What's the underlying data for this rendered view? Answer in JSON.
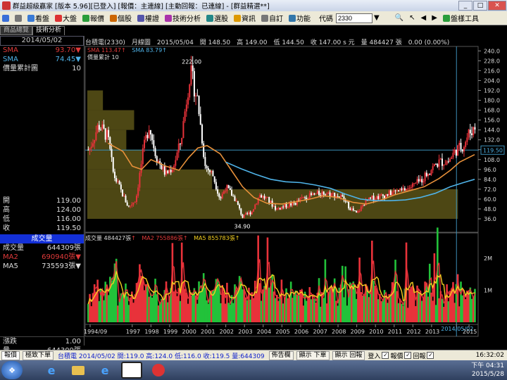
{
  "window": {
    "title": "群益超級贏家 [版本 5.96][已登入] [報價：主連線] [主動回報：已連線] - [群益精選**]",
    "minimize_label": "_",
    "maximize_label": "□",
    "close_label": "✕"
  },
  "menubar": {
    "items": [
      {
        "label": "看盤",
        "icon": "screen-icon",
        "color": "#3a7bd5"
      },
      {
        "label": "大盤",
        "icon": "chart-icon",
        "color": "#d33"
      },
      {
        "label": "報價",
        "icon": "quote-icon",
        "color": "#2a9d3a"
      },
      {
        "label": "個股",
        "icon": "stock-icon",
        "color": "#c60"
      },
      {
        "label": "權證",
        "icon": "warrant-icon",
        "color": "#55a"
      },
      {
        "label": "技術分析",
        "icon": "analysis-icon",
        "color": "#a3a"
      },
      {
        "label": "選股",
        "icon": "screening-icon",
        "color": "#288"
      },
      {
        "label": "資訊",
        "icon": "info-icon",
        "color": "#d90"
      },
      {
        "label": "自訂",
        "icon": "custom-icon",
        "color": "#777"
      },
      {
        "label": "功能",
        "icon": "function-icon",
        "color": "#37a"
      }
    ],
    "code_label": "代碼",
    "code_value": "2330",
    "toolbox_label": "盤樣工具"
  },
  "tabs": [
    {
      "label": "商品總覽",
      "active": false
    },
    {
      "label": "技術分析",
      "active": true
    }
  ],
  "left_panel": {
    "date": "2014/05/02",
    "indicators": [
      {
        "label": "SMA",
        "value": "93.70",
        "arrow": "▼",
        "color": "#e03a3a"
      },
      {
        "label": "SMA",
        "value": "74.45",
        "arrow": "▼",
        "color": "#4fb3e8"
      },
      {
        "label": "價量累計圖",
        "value": "10",
        "arrow": "",
        "color": "#dddddd"
      }
    ],
    "ohlc": [
      {
        "label": "開",
        "value": "119.00"
      },
      {
        "label": "高",
        "value": "124.00"
      },
      {
        "label": "低",
        "value": "116.00"
      },
      {
        "label": "收",
        "value": "119.50"
      }
    ],
    "volume_title": "成交量",
    "volume": [
      {
        "label": "成交量",
        "value": "644309張",
        "arrow": "",
        "color": "#dddddd"
      },
      {
        "label": "MA2",
        "value": "690940張",
        "arrow": "▼",
        "color": "#e03a3a"
      },
      {
        "label": "MA5",
        "value": "735593張",
        "arrow": "▼",
        "color": "#dddddd"
      }
    ],
    "change_label": "漲跌",
    "change_value": "1.00",
    "qty_label": "量",
    "qty_value": "644309張"
  },
  "chart_header": "台積電(2330)　月線圖　2015/05/04　開 148.50　高 149.00　低 144.50　收 147.00 s 元　量 484427 張　0.00 (0.00%)",
  "chart_indicator_legend": {
    "sma1_label": "SMA",
    "sma1_value": "113.47",
    "sma2_label": "SMA",
    "sma2_value": "83.79",
    "vp_label": "價量累計 10"
  },
  "volume_legend": {
    "vol_label": "成交量",
    "vol_value": "484427張",
    "ma2_label": "MA2",
    "ma2_value": "755886張",
    "ma5_label": "MA5",
    "ma5_value": "855783張"
  },
  "chart_data": [
    {
      "type": "candlestick",
      "title": "台積電(2330) 月線圖",
      "ylim": [
        30,
        242
      ],
      "yticks": [
        "240.0",
        "228.0",
        "216.0",
        "204.0",
        "192.0",
        "180.0",
        "168.0",
        "156.0",
        "144.0",
        "132.0",
        "120.0",
        "108.0",
        "96.0",
        "84.0",
        "72.0",
        "60.0",
        "48.0",
        "36.0"
      ],
      "current_price_label": "119.50",
      "annotations": [
        {
          "label": "222.00",
          "year": 2000.1,
          "value": 222
        },
        {
          "label": "34.90",
          "year": 2002.9,
          "value": 34.9
        }
      ],
      "x_axis": [
        "1994/09",
        "1997",
        "1998",
        "1999",
        "2000",
        "2001",
        "2002",
        "2003",
        "2004",
        "2005",
        "2006",
        "2007",
        "2008",
        "2009",
        "2010",
        "2011",
        "2012",
        "2013",
        "2014/05/02",
        "2015"
      ],
      "cursor_year": 2014.33,
      "close_series": [
        [
          1994.7,
          120
        ],
        [
          1995.2,
          150
        ],
        [
          1995.7,
          135
        ],
        [
          1996.0,
          90
        ],
        [
          1996.4,
          70
        ],
        [
          1996.8,
          50
        ],
        [
          1997.2,
          60
        ],
        [
          1997.6,
          120
        ],
        [
          1997.9,
          150
        ],
        [
          1998.3,
          110
        ],
        [
          1998.8,
          90
        ],
        [
          1999.2,
          100
        ],
        [
          1999.6,
          130
        ],
        [
          2000.1,
          215
        ],
        [
          2000.5,
          180
        ],
        [
          2000.9,
          100
        ],
        [
          2001.3,
          90
        ],
        [
          2001.7,
          60
        ],
        [
          2002.0,
          75
        ],
        [
          2002.5,
          60
        ],
        [
          2002.9,
          38
        ],
        [
          2003.4,
          45
        ],
        [
          2003.8,
          65
        ],
        [
          2004.2,
          60
        ],
        [
          2004.7,
          48
        ],
        [
          2005.2,
          52
        ],
        [
          2005.7,
          55
        ],
        [
          2006.2,
          62
        ],
        [
          2006.7,
          65
        ],
        [
          2007.2,
          68
        ],
        [
          2007.7,
          66
        ],
        [
          2008.2,
          62
        ],
        [
          2008.7,
          48
        ],
        [
          2009.0,
          42
        ],
        [
          2009.4,
          55
        ],
        [
          2009.9,
          62
        ],
        [
          2010.4,
          64
        ],
        [
          2010.9,
          68
        ],
        [
          2011.4,
          70
        ],
        [
          2011.9,
          75
        ],
        [
          2012.4,
          82
        ],
        [
          2012.9,
          95
        ],
        [
          2013.4,
          105
        ],
        [
          2013.9,
          106
        ],
        [
          2014.3,
          119.5
        ],
        [
          2014.7,
          125
        ],
        [
          2015.0,
          140
        ],
        [
          2015.3,
          147
        ]
      ],
      "sma1_series": [
        [
          1995.7,
          128
        ],
        [
          1996.5,
          118
        ],
        [
          1997.0,
          100
        ],
        [
          1997.5,
          96
        ],
        [
          1998.0,
          108
        ],
        [
          1998.8,
          100
        ],
        [
          1999.5,
          95
        ],
        [
          2000.0,
          110
        ],
        [
          2000.5,
          122
        ],
        [
          2001.0,
          125
        ],
        [
          2001.7,
          115
        ],
        [
          2002.3,
          95
        ],
        [
          2002.9,
          75
        ],
        [
          2003.5,
          62
        ],
        [
          2004.2,
          55
        ],
        [
          2005.0,
          54
        ],
        [
          2005.8,
          57
        ],
        [
          2006.5,
          60
        ],
        [
          2007.2,
          64
        ],
        [
          2008.0,
          62
        ],
        [
          2008.8,
          56
        ],
        [
          2009.5,
          54
        ],
        [
          2010.2,
          58
        ],
        [
          2011.0,
          65
        ],
        [
          2011.8,
          70
        ],
        [
          2012.6,
          75
        ],
        [
          2013.4,
          85
        ],
        [
          2014.0,
          95
        ],
        [
          2014.5,
          105
        ],
        [
          2015.3,
          114
        ]
      ],
      "sma2_series": [
        [
          2002.0,
          105
        ],
        [
          2002.8,
          97
        ],
        [
          2003.6,
          90
        ],
        [
          2004.4,
          84
        ],
        [
          2005.2,
          81
        ],
        [
          2006.0,
          80
        ],
        [
          2006.8,
          77
        ],
        [
          2007.6,
          73
        ],
        [
          2008.4,
          66
        ],
        [
          2009.2,
          60
        ],
        [
          2010.0,
          58
        ],
        [
          2010.8,
          58
        ],
        [
          2011.6,
          59
        ],
        [
          2012.4,
          62
        ],
        [
          2013.2,
          67
        ],
        [
          2014.0,
          75
        ],
        [
          2014.7,
          80
        ],
        [
          2015.3,
          84
        ]
      ],
      "volume_profile": [
        {
          "price_low": 36,
          "price_high": 72,
          "weight": 0.95
        },
        {
          "price_low": 72,
          "price_high": 96,
          "weight": 0.32
        },
        {
          "price_low": 96,
          "price_high": 120,
          "weight": 0.14
        },
        {
          "price_low": 120,
          "price_high": 144,
          "weight": 0.1
        },
        {
          "price_low": 144,
          "price_high": 168,
          "weight": 0.12
        },
        {
          "price_low": 168,
          "price_high": 192,
          "weight": 0.04
        }
      ]
    },
    {
      "type": "bar",
      "title": "成交量",
      "ylim": [
        0,
        2600000
      ],
      "yticks": [
        "2M",
        "1M"
      ],
      "ma_series_names": [
        "MA2",
        "MA5"
      ]
    }
  ],
  "taskline": {
    "tab_label": "報價",
    "ticker_label": "極致下單",
    "ticker_text": "台積電 2014/05/02 開:119.0 高:124.0 低:116.0 收:119.5 量:644309",
    "buttons": [
      "佈告欄",
      "顯示 下單",
      "顯示 回報"
    ],
    "checks": [
      {
        "label": "登入",
        "checked": true
      },
      {
        "label": "報價",
        "checked": true
      },
      {
        "label": "回報",
        "checked": true
      }
    ],
    "time": "16:32:02"
  },
  "taskbar": {
    "clock_time": "下午 04:31",
    "clock_date": "2015/5/28"
  }
}
